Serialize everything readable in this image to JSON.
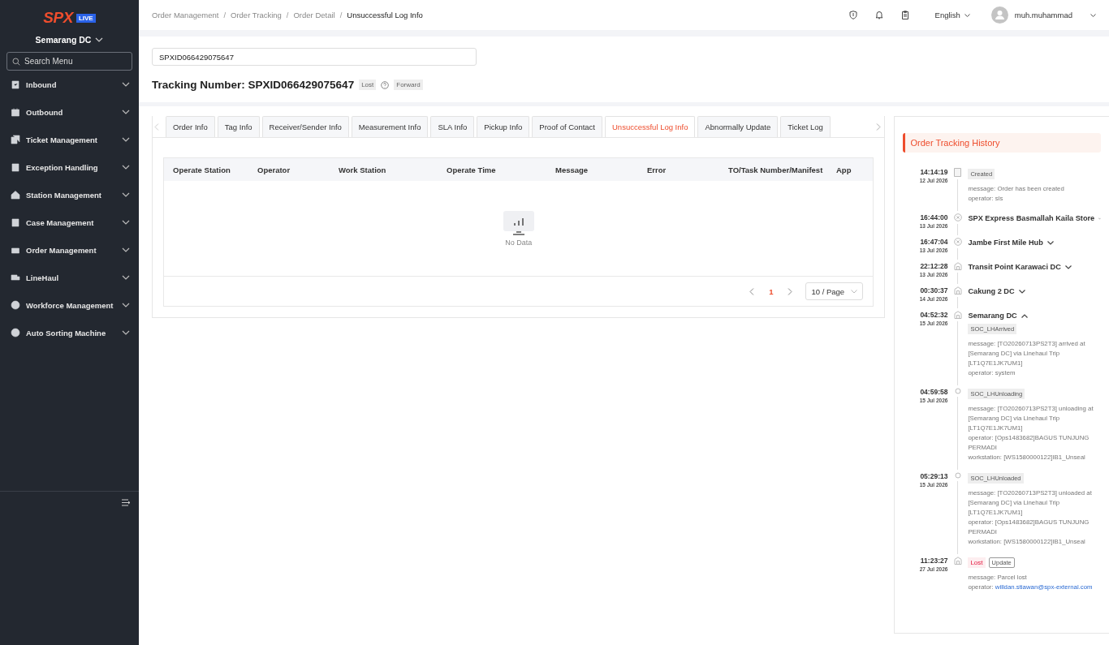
{
  "sidebar": {
    "logo": "SPX",
    "badge": "LIVE",
    "station": "Semarang DC",
    "search": {
      "placeholder": "Search Menu"
    },
    "items": [
      {
        "label": "Inbound",
        "expanded": false
      },
      {
        "label": "Outbound",
        "expanded": false
      },
      {
        "label": "Ticket Management",
        "expanded": false
      },
      {
        "label": "Exception Handling",
        "expanded": false
      },
      {
        "label": "Station Management",
        "expanded": false
      },
      {
        "label": "Case Management",
        "expanded": false
      },
      {
        "label": "Order Management",
        "expanded": false
      },
      {
        "label": "LineHaul",
        "expanded": false
      },
      {
        "label": "Workforce Management",
        "expanded": false
      },
      {
        "label": "Auto Sorting Machine",
        "expanded": false
      }
    ]
  },
  "breadcrumb": {
    "separator": "/",
    "items": [
      "Order Management",
      "Order Tracking",
      "Order Detail",
      "Unsuccessful Log Info"
    ]
  },
  "header": {
    "language": "English",
    "user": "muh.muhammad"
  },
  "search": {
    "value": "SPXID066429075647"
  },
  "tracking": {
    "label": "Tracking Number: SPXID066429075647",
    "tags": [
      "Lost",
      "Forward"
    ]
  },
  "tabs": [
    {
      "label": "Order Info",
      "selected": false
    },
    {
      "label": "Tag Info",
      "selected": false
    },
    {
      "label": "Receiver/Sender Info",
      "selected": false
    },
    {
      "label": "Measurement Info",
      "selected": false
    },
    {
      "label": "SLA Info",
      "selected": false
    },
    {
      "label": "Pickup Info",
      "selected": false
    },
    {
      "label": "Proof of Contact",
      "selected": false
    },
    {
      "label": "Unsuccessful Log Info",
      "selected": true
    },
    {
      "label": "Abnormally Update",
      "selected": false
    },
    {
      "label": "Ticket Log",
      "selected": false
    }
  ],
  "table": {
    "columns": [
      "Operate Station",
      "Operator",
      "Work Station",
      "Operate Time",
      "Message",
      "Error",
      "TO/Task Number/Manifest",
      "App"
    ],
    "empty": "No Data"
  },
  "pagination": {
    "page": "1",
    "page_size": "10 / Page"
  },
  "history": {
    "title": "Order Tracking History",
    "events": [
      {
        "time": "14:14:19",
        "date": "12 Jul 2026",
        "kind": "document",
        "tags": [
          {
            "label": "Created",
            "kind": "plain"
          }
        ],
        "lines": [
          {
            "text": "message: Order has been created"
          },
          {
            "text": "operator: sls"
          }
        ]
      },
      {
        "time": "16:44:00",
        "date": "13 Jul 2026",
        "kind": "cancelled",
        "station": {
          "name": "SPX Express Basmallah Kaila Store",
          "expanded": false
        }
      },
      {
        "time": "16:47:04",
        "date": "13 Jul 2026",
        "kind": "cancelled",
        "station": {
          "name": "Jambe First Mile Hub",
          "expanded": false
        }
      },
      {
        "time": "22:12:28",
        "date": "13 Jul 2026",
        "kind": "station",
        "station": {
          "name": "Transit Point Karawaci DC",
          "expanded": false
        }
      },
      {
        "time": "00:30:37",
        "date": "14 Jul 2026",
        "kind": "station",
        "station": {
          "name": "Cakung 2 DC",
          "expanded": false
        }
      },
      {
        "time": "04:52:32",
        "date": "15 Jul 2026",
        "kind": "station",
        "station": {
          "name": "Semarang DC",
          "expanded": true
        },
        "tags": [
          {
            "label": "SOC_LHArrived",
            "kind": "plain"
          }
        ],
        "lines": [
          {
            "text": "message: [TO20260713PS2T3] arrived at [Semarang DC] via Linehaul Trip [LT1Q7E1JK7UM1]"
          },
          {
            "text": "operator: system"
          }
        ]
      },
      {
        "time": "04:59:58",
        "date": "15 Jul 2026",
        "kind": "step",
        "tags": [
          {
            "label": "SOC_LHUnloading",
            "kind": "plain"
          }
        ],
        "lines": [
          {
            "text": "message: [TO20260713PS2T3] unloading at [Semarang DC] via Linehaul Trip [LT1Q7E1JK7UM1]"
          },
          {
            "text": "operator: [Ops1483682]BAGUS TUNJUNG PERMADI"
          },
          {
            "text": "workstation: [WS1580000122]IB1_Unseal"
          }
        ]
      },
      {
        "time": "05:29:13",
        "date": "15 Jul 2026",
        "kind": "step",
        "tags": [
          {
            "label": "SOC_LHUnloaded",
            "kind": "plain"
          }
        ],
        "lines": [
          {
            "text": "message: [TO20260713PS2T3] unloaded at [Semarang DC] via Linehaul Trip [LT1Q7E1JK7UM1]"
          },
          {
            "text": "operator: [Ops1483682]BAGUS TUNJUNG PERMADI"
          },
          {
            "text": "workstation: [WS1580000122]IB1_Unseal"
          }
        ]
      },
      {
        "time": "11:23:27",
        "date": "27 Jul 2026",
        "kind": "station",
        "tags": [
          {
            "label": "Lost",
            "kind": "danger"
          },
          {
            "label": "Update",
            "kind": "outline"
          }
        ],
        "lines": [
          {
            "text": "message: Parcel lost"
          },
          {
            "text": "operator: ",
            "link": "willdan.stiawan@spx-external.com"
          }
        ]
      }
    ]
  }
}
